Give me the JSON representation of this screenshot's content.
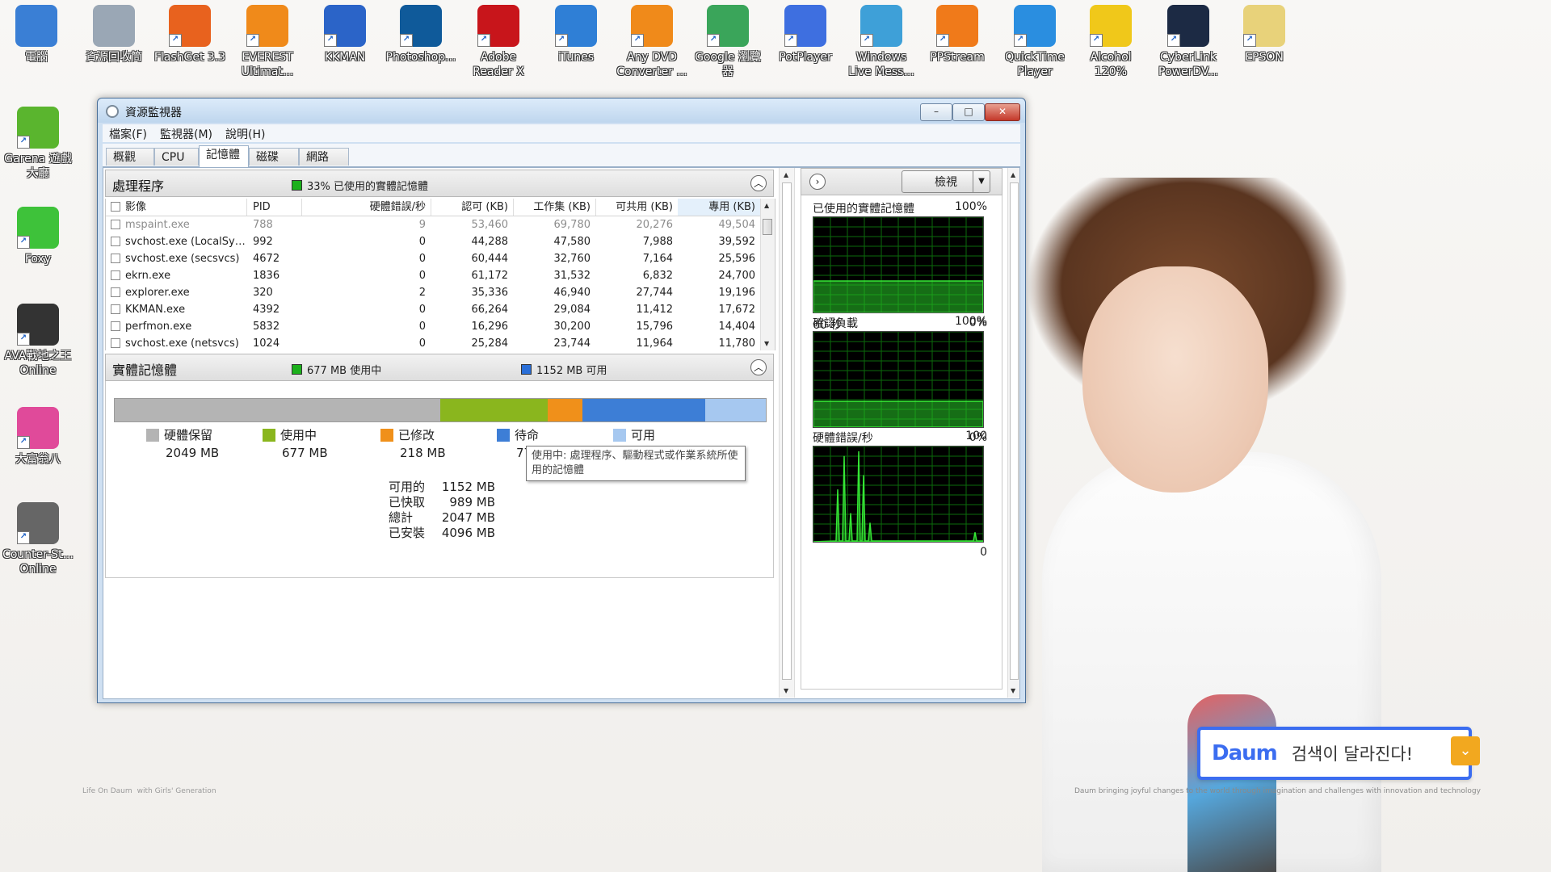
{
  "desktop": {
    "icons": [
      {
        "label": "電腦",
        "icon": "computer-icon",
        "color": "#3a7fd5"
      },
      {
        "label": "資源回收筒",
        "icon": "recycle-bin-icon",
        "color": "#9aa7b5"
      },
      {
        "label": "FlashGet 3.3",
        "icon": "flashget-icon",
        "color": "#e8621e"
      },
      {
        "label": "EVEREST Ultimat...",
        "icon": "everest-icon",
        "color": "#f08a1a"
      },
      {
        "label": "KKMAN",
        "icon": "kkman-icon",
        "color": "#2b64c8"
      },
      {
        "label": "Photoshop...",
        "icon": "photoshop-icon",
        "color": "#0f5a9a"
      },
      {
        "label": "Adobe Reader X",
        "icon": "adobe-reader-icon",
        "color": "#c8151b"
      },
      {
        "label": "iTunes",
        "icon": "itunes-icon",
        "color": "#2f7fd6"
      },
      {
        "label": "Any DVD Converter ...",
        "icon": "dvd-converter-icon",
        "color": "#f08a1a"
      },
      {
        "label": "Google 瀏覽器",
        "icon": "chrome-icon",
        "color": "#3aa55a"
      },
      {
        "label": "PotPlayer",
        "icon": "potplayer-icon",
        "color": "#3e6fe0"
      },
      {
        "label": "Windows Live Mess...",
        "icon": "messenger-icon",
        "color": "#3ea0d8"
      },
      {
        "label": "PPStream",
        "icon": "ppstream-icon",
        "color": "#f07a1a"
      },
      {
        "label": "QuickTime Player",
        "icon": "quicktime-icon",
        "color": "#2a8ee0"
      },
      {
        "label": "Alcohol 120%",
        "icon": "alcohol-icon",
        "color": "#f0c81a"
      },
      {
        "label": "CyberLink PowerDV...",
        "icon": "powerdvd-icon",
        "color": "#1c2a44"
      },
      {
        "label": "EPSON",
        "icon": "folder-icon",
        "color": "#e8d27a"
      },
      {
        "label": "Garena 遊戲大廳",
        "icon": "garena-icon",
        "color": "#5ab52e"
      },
      {
        "label": "Foxy",
        "icon": "foxy-icon",
        "color": "#3ec23a"
      },
      {
        "label": "AVA戰地之王 Online",
        "icon": "ava-icon",
        "color": "#333333"
      },
      {
        "label": "大富翁八",
        "icon": "richman-icon",
        "color": "#e04a9a"
      },
      {
        "label": "Counter-St... Online",
        "icon": "counter-strike-icon",
        "color": "#666666"
      }
    ],
    "wallpaper": {
      "brand_left": "Life On Daum",
      "brand_left_sub": "with Girls' Generation",
      "tagline": "Daum bringing joyful changes to the world through imagination and challenges with innovation and technology",
      "search_logo": "Daum",
      "search_text": "검색이 달라진다!"
    }
  },
  "window": {
    "title": "資源監視器",
    "menu": [
      "檔案(F)",
      "監視器(M)",
      "說明(H)"
    ],
    "tabs": [
      "概觀",
      "CPU",
      "記憶體",
      "磁碟",
      "網路"
    ],
    "active_tab": "記憶體",
    "minimize": "–",
    "maximize": "□",
    "close": "✕"
  },
  "processes": {
    "title": "處理程序",
    "legend": "33% 已使用的實體記憶體",
    "legend_color": "#1bb01b",
    "columns": [
      "影像",
      "PID",
      "硬體錯誤/秒",
      "認可 (KB)",
      "工作集 (KB)",
      "可共用 (KB)",
      "專用 (KB)"
    ],
    "rows": [
      {
        "name": "mspaint.exe",
        "pid": "788",
        "faults": "9",
        "commit": "53,460",
        "working": "69,780",
        "shareable": "20,276",
        "private": "49,504",
        "dim": true
      },
      {
        "name": "svchost.exe (LocalSyste...",
        "pid": "992",
        "faults": "0",
        "commit": "44,288",
        "working": "47,580",
        "shareable": "7,988",
        "private": "39,592"
      },
      {
        "name": "svchost.exe (secsvcs)",
        "pid": "4672",
        "faults": "0",
        "commit": "60,444",
        "working": "32,760",
        "shareable": "7,164",
        "private": "25,596"
      },
      {
        "name": "ekrn.exe",
        "pid": "1836",
        "faults": "0",
        "commit": "61,172",
        "working": "31,532",
        "shareable": "6,832",
        "private": "24,700"
      },
      {
        "name": "explorer.exe",
        "pid": "320",
        "faults": "2",
        "commit": "35,336",
        "working": "46,940",
        "shareable": "27,744",
        "private": "19,196"
      },
      {
        "name": "KKMAN.exe",
        "pid": "4392",
        "faults": "0",
        "commit": "66,264",
        "working": "29,084",
        "shareable": "11,412",
        "private": "17,672"
      },
      {
        "name": "perfmon.exe",
        "pid": "5832",
        "faults": "0",
        "commit": "16,296",
        "working": "30,200",
        "shareable": "15,796",
        "private": "14,404"
      },
      {
        "name": "svchost.exe (netsvcs)",
        "pid": "1024",
        "faults": "0",
        "commit": "25,284",
        "working": "23,744",
        "shareable": "11,964",
        "private": "11,780"
      }
    ]
  },
  "physical": {
    "title": "實體記憶體",
    "legend_in_use": "677 MB 使用中",
    "legend_in_use_color": "#1bb01b",
    "legend_available": "1152 MB 可用",
    "legend_available_color": "#2a6fd8",
    "bar": [
      {
        "label": "硬體保留",
        "value": "2049 MB",
        "mb": 2049,
        "color": "#b4b4b4"
      },
      {
        "label": "使用中",
        "value": "677 MB",
        "mb": 677,
        "color": "#8ab61e"
      },
      {
        "label": "已修改",
        "value": "218 MB",
        "mb": 218,
        "color": "#f0901a"
      },
      {
        "label": "待命",
        "value": "771 MB",
        "mb": 771,
        "color": "#3d7ed6"
      },
      {
        "label": "可用",
        "value": "381 MB",
        "mb": 381,
        "color": "#a6c8f0"
      }
    ],
    "tooltip": "使用中: 處理程序、驅動程式或作業系統所使用的記憶體",
    "stats": [
      {
        "key": "可用的",
        "value": "1152 MB"
      },
      {
        "key": "已快取",
        "value": "989 MB"
      },
      {
        "key": "總計",
        "value": "2047 MB"
      },
      {
        "key": "已安裝",
        "value": "4096 MB"
      }
    ]
  },
  "graphs": {
    "view_label": "檢視",
    "items": [
      {
        "title": "已使用的實體記憶體",
        "max": "100%",
        "footer_left": "60 秒",
        "footer_right": "0%",
        "level": 0.33
      },
      {
        "title": "確認負載",
        "max": "100%",
        "footer_left": "",
        "footer_right": "0%",
        "level": 0.27
      },
      {
        "title": "硬體錯誤/秒",
        "max": "100",
        "footer_left": "",
        "footer_right": "0",
        "level": 0.0
      }
    ]
  }
}
